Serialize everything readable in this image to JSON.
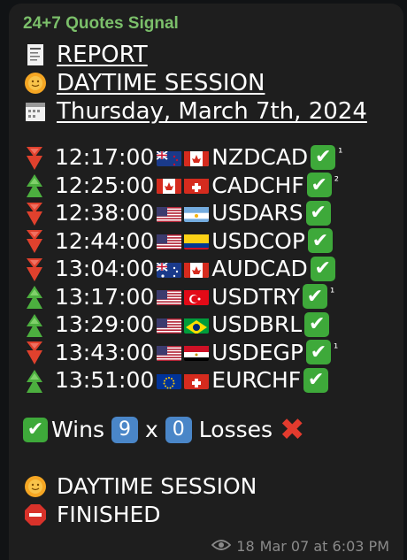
{
  "channel": {
    "name": "24+7 Quotes Signal"
  },
  "header": {
    "report": "REPORT",
    "session": "DAYTIME SESSION",
    "date": "Thursday, March 7th, 2024"
  },
  "signals": [
    {
      "dir": "down",
      "time": "12:17:00",
      "pair": "NZDCAD",
      "flags": [
        "nz",
        "ca"
      ],
      "sup": "¹"
    },
    {
      "dir": "up",
      "time": "12:25:00",
      "pair": "CADCHF",
      "flags": [
        "ca",
        "ch"
      ],
      "sup": "²"
    },
    {
      "dir": "down",
      "time": "12:38:00",
      "pair": "USDARS",
      "flags": [
        "us",
        "ar"
      ],
      "sup": ""
    },
    {
      "dir": "down",
      "time": "12:44:00",
      "pair": "USDCOP",
      "flags": [
        "us",
        "co"
      ],
      "sup": ""
    },
    {
      "dir": "down",
      "time": "13:04:00",
      "pair": "AUDCAD",
      "flags": [
        "au",
        "ca"
      ],
      "sup": ""
    },
    {
      "dir": "up",
      "time": "13:17:00",
      "pair": "USDTRY",
      "flags": [
        "us",
        "tr"
      ],
      "sup": "¹"
    },
    {
      "dir": "up",
      "time": "13:29:00",
      "pair": "USDBRL",
      "flags": [
        "us",
        "br"
      ],
      "sup": ""
    },
    {
      "dir": "down",
      "time": "13:43:00",
      "pair": "USDEGP",
      "flags": [
        "us",
        "eg"
      ],
      "sup": "¹"
    },
    {
      "dir": "up",
      "time": "13:51:00",
      "pair": "EURCHF",
      "flags": [
        "eu",
        "ch"
      ],
      "sup": ""
    }
  ],
  "summary": {
    "wins_label": "Wins",
    "wins": "9",
    "x": "x",
    "losses": "0",
    "losses_label": "Losses"
  },
  "footer": {
    "session": "DAYTIME SESSION",
    "finished": "FINISHED"
  },
  "meta": {
    "views": "18",
    "timestamp": "Mar 07 at 6:03 PM"
  },
  "colors": {
    "sender": "#7bbf6a",
    "check": "#3ea93a",
    "down": "#e0412d",
    "up": "#4caf3f"
  }
}
